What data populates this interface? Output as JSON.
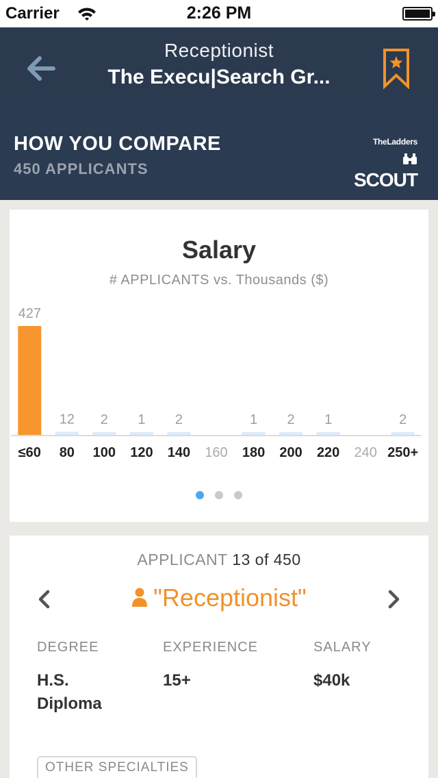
{
  "status_bar": {
    "carrier": "Carrier",
    "time": "2:26 PM"
  },
  "nav": {
    "job_title": "Receptionist",
    "company": "The Execu|Search Gr..."
  },
  "compare": {
    "heading": "HOW YOU COMPARE",
    "applicants": "450 APPLICANTS",
    "logo_small": "TheLadders",
    "logo_big": "SCOUT"
  },
  "chart": {
    "title": "Salary",
    "subtitle": "# APPLICANTS vs. Thousands ($)"
  },
  "chart_data": {
    "type": "bar",
    "title": "Salary",
    "subtitle": "# APPLICANTS vs. Thousands ($)",
    "categories": [
      "≤60",
      "80",
      "100",
      "120",
      "140",
      "160",
      "180",
      "200",
      "220",
      "240",
      "250+"
    ],
    "values": [
      427,
      12,
      2,
      1,
      2,
      0,
      1,
      2,
      1,
      0,
      2
    ],
    "labels": [
      "427",
      "12",
      "2",
      "1",
      "2",
      "",
      "1",
      "2",
      "1",
      "",
      "2"
    ],
    "highlight_index": 0,
    "colors": {
      "highlight": "#f7952f",
      "bar": "#dcebfa",
      "label": "#9e9e9e",
      "axis": "#d0d0d0",
      "tick_active": "#222222",
      "tick_empty": "#aaaaaa"
    }
  },
  "pager": {
    "pages": 3,
    "active": 0,
    "active_color": "#4aa8ee"
  },
  "applicant": {
    "count_prefix": "APPLICANT",
    "count_value": "13 of 450",
    "role": "\"Receptionist\"",
    "degree_label": "DEGREE",
    "degree_value": "H.S. Diploma",
    "experience_label": "EXPERIENCE",
    "experience_value": "15+",
    "salary_label": "SALARY",
    "salary_value": "$40k",
    "specialties_label": "OTHER SPECIALTIES"
  },
  "icons": {
    "back": "arrow-left-icon",
    "bookmark": "bookmark-star-icon",
    "prev": "chevron-left-icon",
    "next": "chevron-right-icon",
    "person": "person-icon",
    "wifi": "wifi-icon",
    "battery": "battery-icon",
    "binoculars": "binoculars-icon"
  },
  "theme": {
    "navy": "#2b3a4e",
    "accent": "#f1922b"
  }
}
